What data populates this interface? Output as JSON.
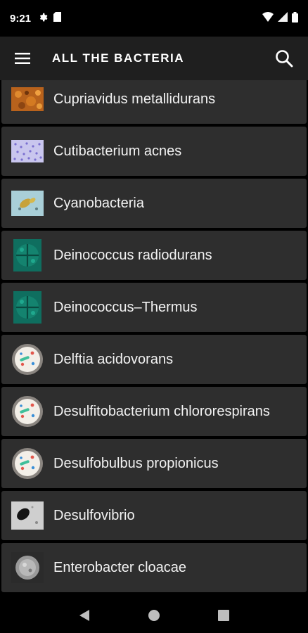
{
  "status_bar": {
    "time": "9:21",
    "left_icons": [
      "gear-icon",
      "sd-card-icon"
    ],
    "right_icons": [
      "wifi-icon",
      "cell-signal-icon",
      "battery-icon"
    ]
  },
  "app_bar": {
    "title": "ALL THE BACTERIA",
    "menu_icon": "hamburger-menu-icon",
    "search_icon": "search-icon",
    "background": "#1f1f1f"
  },
  "list": {
    "items": [
      {
        "label": "Cupriavidus metallidurans",
        "thumbnail": "orange-microscopy-thumbnail"
      },
      {
        "label": "Cutibacterium acnes",
        "thumbnail": "purple-microscopy-thumbnail"
      },
      {
        "label": "Cyanobacteria",
        "thumbnail": "blue-microscopy-thumbnail"
      },
      {
        "label": "Deinococcus radiodurans",
        "thumbnail": "teal-tetrad-thumbnail"
      },
      {
        "label": "Deinococcus–Thermus",
        "thumbnail": "teal-tetrad-thumbnail"
      },
      {
        "label": "Delftia acidovorans",
        "thumbnail": "petri-dish-icon"
      },
      {
        "label": "Desulfitobacterium chlororespirans",
        "thumbnail": "petri-dish-icon"
      },
      {
        "label": "Desulfobulbus propionicus",
        "thumbnail": "petri-dish-icon"
      },
      {
        "label": "Desulfovibrio",
        "thumbnail": "gray-microscopy-thumbnail"
      },
      {
        "label": "Enterobacter cloacae",
        "thumbnail": "gray-colony-thumbnail"
      }
    ]
  },
  "nav_bar": {
    "buttons": [
      "back-icon",
      "home-icon",
      "recents-icon"
    ]
  }
}
